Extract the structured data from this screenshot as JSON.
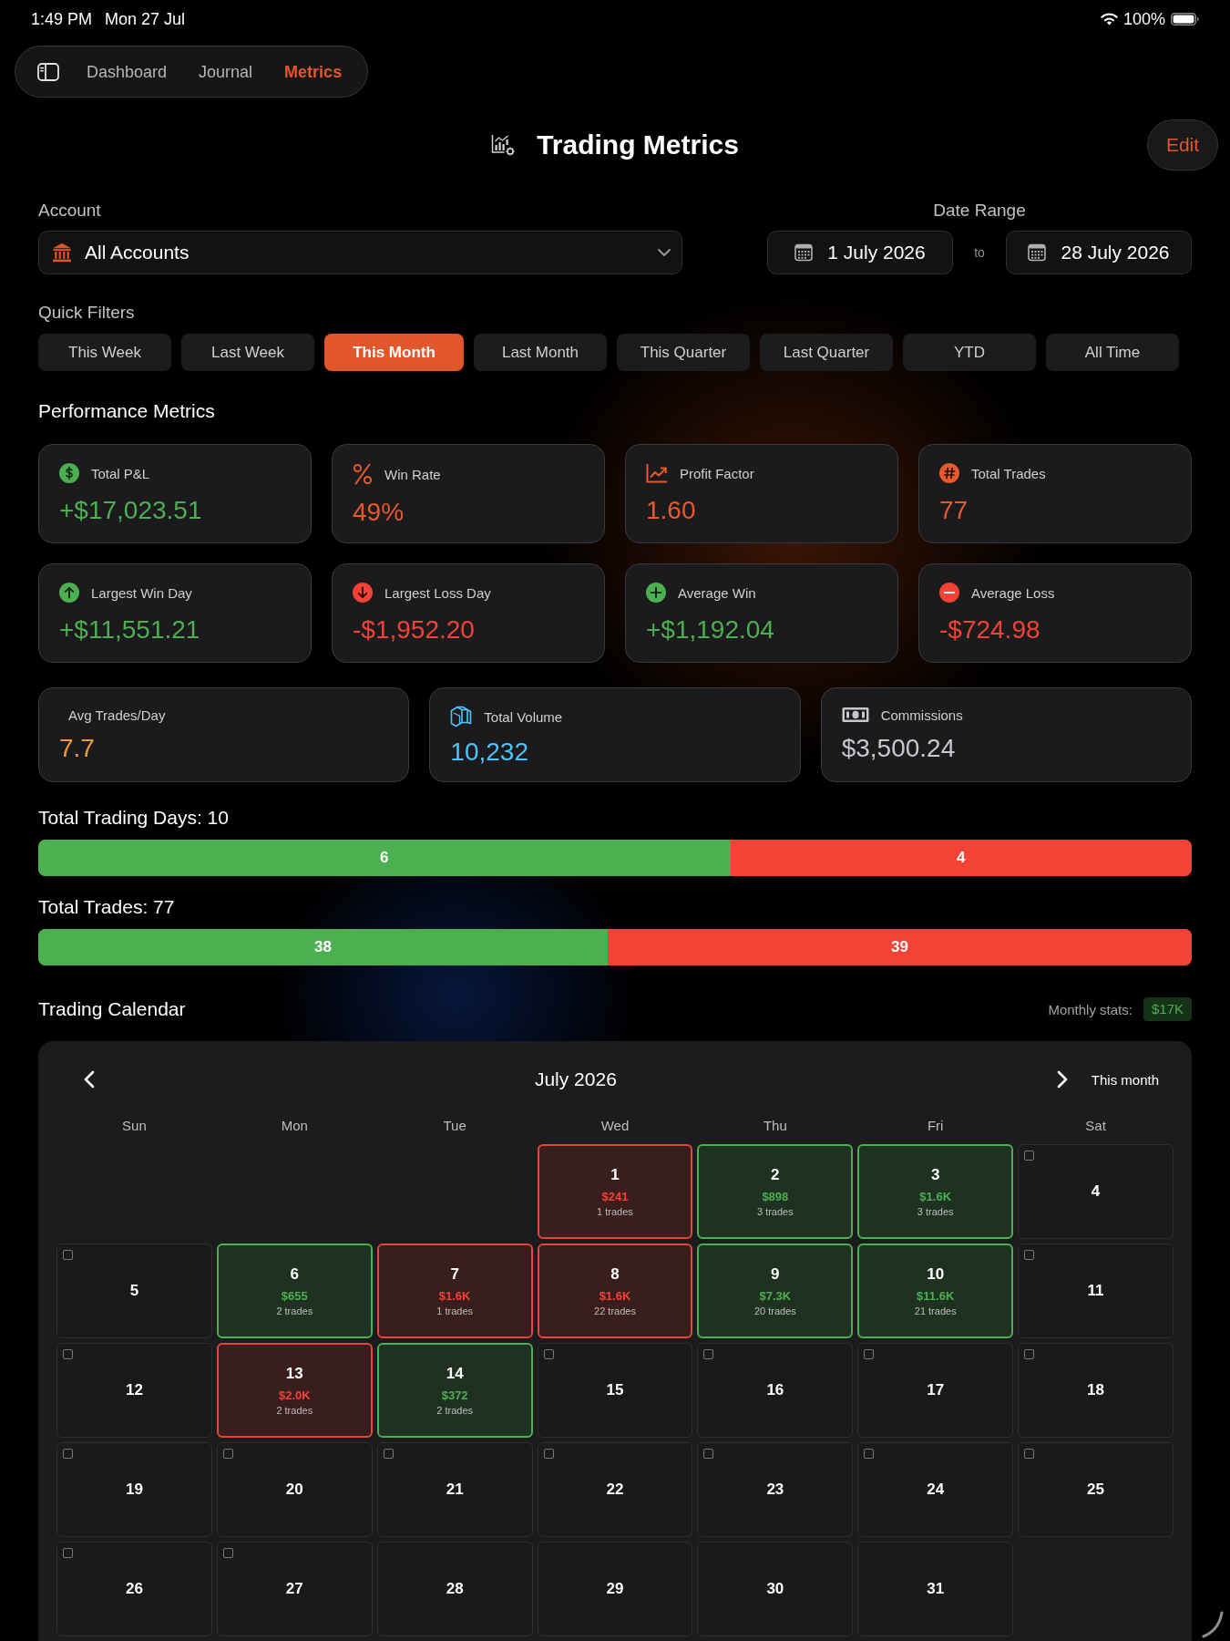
{
  "status_bar": {
    "time": "1:49 PM",
    "date": "Mon 27 Jul",
    "battery": "100%"
  },
  "nav": {
    "tabs": [
      {
        "label": "Dashboard",
        "selected": false
      },
      {
        "label": "Journal",
        "selected": false
      },
      {
        "label": "Metrics",
        "selected": true
      }
    ]
  },
  "header": {
    "title": "Trading Metrics",
    "edit_button": "Edit"
  },
  "account": {
    "label": "Account",
    "value": "All Accounts"
  },
  "date_range": {
    "label": "Date Range",
    "from": "1 July 2026",
    "separator": "to",
    "to": "28 July 2026"
  },
  "quick_filters": {
    "label": "Quick Filters",
    "options": [
      {
        "label": "This Week",
        "selected": false
      },
      {
        "label": "Last Week",
        "selected": false
      },
      {
        "label": "This Month",
        "selected": true
      },
      {
        "label": "Last Month",
        "selected": false
      },
      {
        "label": "This Quarter",
        "selected": false
      },
      {
        "label": "Last Quarter",
        "selected": false
      },
      {
        "label": "YTD",
        "selected": false
      },
      {
        "label": "All Time",
        "selected": false
      }
    ]
  },
  "performance_metrics": {
    "title": "Performance Metrics",
    "rows": [
      {
        "cards": [
          {
            "kind": "pnl",
            "label": "Total P&L",
            "value": "+$17,023.51",
            "color": "#4caf50"
          },
          {
            "kind": "winrate",
            "label": "Win Rate",
            "value": "49%",
            "color": "#e65a2b"
          },
          {
            "kind": "factor",
            "label": "Profit Factor",
            "value": "1.60",
            "color": "#e65a2b"
          },
          {
            "kind": "count",
            "label": "Total Trades",
            "value": "77",
            "color": "#e65a2b"
          }
        ]
      },
      {
        "cards": [
          {
            "kind": "bestday",
            "label": "Largest Win Day",
            "value": "+$11,551.21",
            "color": "#4caf50"
          },
          {
            "kind": "worstday",
            "label": "Largest Loss Day",
            "value": "-$1,952.20",
            "color": "#f44336"
          },
          {
            "kind": "avgwin",
            "label": "Average Win",
            "value": "+$1,192.04",
            "color": "#4caf50"
          },
          {
            "kind": "avgloss",
            "label": "Average Loss",
            "value": "-$724.98",
            "color": "#f44336"
          }
        ]
      },
      {
        "cards": [
          {
            "kind": "pace",
            "label": "Avg Trades/Day",
            "value": "7.7",
            "color": "#f39a33"
          },
          {
            "kind": "volume",
            "label": "Total Volume",
            "value": "10,232",
            "color": "#4fc3f7"
          },
          {
            "kind": "fees",
            "label": "Commissions",
            "value": "$3,500.24",
            "color": "#c7c7cc"
          }
        ]
      }
    ]
  },
  "distribution": [
    {
      "label": "Total Trading Days: 10",
      "wins": "6",
      "losses": "4",
      "level": 0.6
    },
    {
      "label": "Total Trades: 77",
      "wins": "38",
      "losses": "39",
      "level": 0.4935
    }
  ],
  "calendar": {
    "title": "Trading Calendar",
    "stats_label": "Monthly stats:",
    "stats_value": "$17K",
    "month": "July 2026",
    "today_button": "This month",
    "weekdays": [
      "Sun",
      "Mon",
      "Tue",
      "Wed",
      "Thu",
      "Fri",
      "Sat"
    ],
    "weeks": [
      {
        "days": [
          {
            "day": "1",
            "kind": "loss",
            "pnl": "$241",
            "trades": "1 trades"
          },
          {
            "day": "2",
            "kind": "win",
            "pnl": "$898",
            "trades": "3 trades"
          },
          {
            "day": "3",
            "kind": "win",
            "pnl": "$1.6K",
            "trades": "3 trades"
          },
          {
            "day": "4",
            "kind": "open",
            "checked": false
          }
        ]
      },
      {
        "days": [
          {
            "day": "5",
            "kind": "open",
            "checked": false
          },
          {
            "day": "6",
            "kind": "win",
            "pnl": "$655",
            "trades": "2 trades"
          },
          {
            "day": "7",
            "kind": "loss",
            "pnl": "$1.6K",
            "trades": "1 trades"
          },
          {
            "day": "8",
            "kind": "loss",
            "pnl": "$1.6K",
            "trades": "22 trades"
          },
          {
            "day": "9",
            "kind": "win",
            "pnl": "$7.3K",
            "trades": "20 trades"
          },
          {
            "day": "10",
            "kind": "win",
            "pnl": "$11.6K",
            "trades": "21 trades"
          },
          {
            "day": "11",
            "kind": "open",
            "checked": false
          }
        ]
      },
      {
        "days": [
          {
            "day": "12",
            "kind": "open",
            "checked": false
          },
          {
            "day": "13",
            "kind": "loss",
            "pnl": "$2.0K",
            "trades": "2 trades"
          },
          {
            "day": "14",
            "kind": "win",
            "pnl": "$372",
            "trades": "2 trades"
          },
          {
            "day": "15",
            "kind": "open",
            "checked": false
          },
          {
            "day": "16",
            "kind": "open",
            "checked": false
          },
          {
            "day": "17",
            "kind": "open",
            "checked": false
          },
          {
            "day": "18",
            "kind": "open",
            "checked": false
          }
        ]
      },
      {
        "days": [
          {
            "day": "19",
            "kind": "open",
            "checked": false
          },
          {
            "day": "20",
            "kind": "open",
            "checked": false
          },
          {
            "day": "21",
            "kind": "open",
            "checked": false
          },
          {
            "day": "22",
            "kind": "open",
            "checked": false
          },
          {
            "day": "23",
            "kind": "open",
            "checked": false
          },
          {
            "day": "24",
            "kind": "open",
            "checked": false
          },
          {
            "day": "25",
            "kind": "open",
            "checked": false
          }
        ]
      },
      {
        "days": [
          {
            "day": "26",
            "kind": "open",
            "checked": false
          },
          {
            "day": "27",
            "kind": "open",
            "checked": false
          },
          {
            "day": "28",
            "kind": "future"
          },
          {
            "day": "29",
            "kind": "future"
          },
          {
            "day": "30",
            "kind": "future"
          },
          {
            "day": "31",
            "kind": "future"
          }
        ]
      }
    ]
  }
}
